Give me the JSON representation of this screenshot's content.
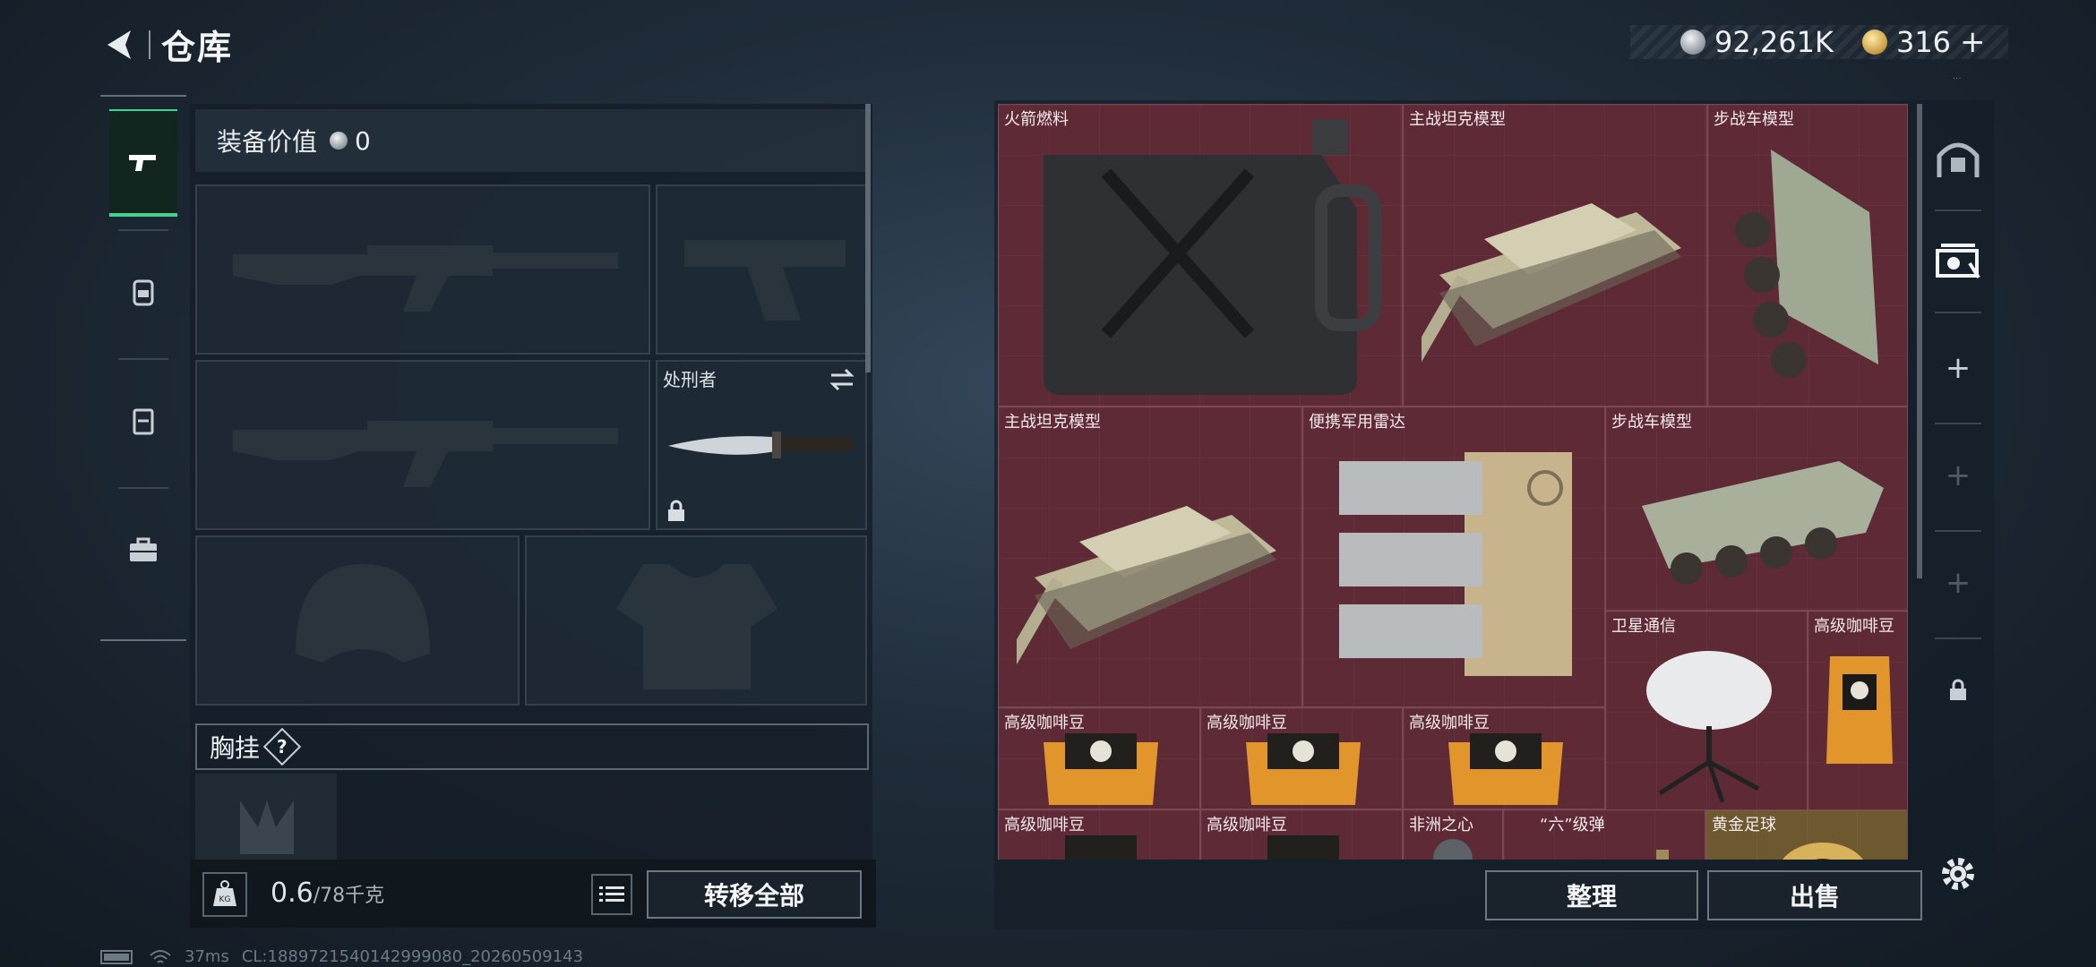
{
  "header": {
    "title": "仓库"
  },
  "currency": {
    "silver": "92,261K",
    "gold": "316"
  },
  "version": "...",
  "sidebar_left": {
    "tabs": [
      "weapon-tab",
      "backpack-tab",
      "chest-rig-tab",
      "case-tab"
    ]
  },
  "equipment": {
    "value_label": "装备价值",
    "value": "0",
    "melee_label": "处刑者",
    "chest_rig_label": "胸挂"
  },
  "footer_left": {
    "weight_current": "0.6",
    "weight_max": "/78千克",
    "kg_badge": "KG",
    "transfer_all": "转移全部"
  },
  "stash_items": [
    {
      "name": "火箭燃料"
    },
    {
      "name": "主战坦克模型"
    },
    {
      "name": "步战车模型"
    },
    {
      "name": "主战坦克模型"
    },
    {
      "name": "便携军用雷达"
    },
    {
      "name": "步战车模型"
    },
    {
      "name": "卫星通信"
    },
    {
      "name": "高级咖啡豆"
    },
    {
      "name": "高级咖啡豆"
    },
    {
      "name": "高级咖啡豆"
    },
    {
      "name": "高级咖啡豆"
    },
    {
      "name": "高级咖啡豆"
    },
    {
      "name": "高级咖啡豆"
    },
    {
      "name": "非洲之心"
    },
    {
      "name": "“六”级弹"
    },
    {
      "name": "黄金足球"
    }
  ],
  "footer_right": {
    "organize": "整理",
    "sell": "出售"
  },
  "status_bar": {
    "ping": "37ms",
    "id": "CL:1889721540142999080_20260509143"
  },
  "colors": {
    "accent_green": "#46d18f",
    "grid_red": "#5e2a36",
    "gold": "#c79a3c"
  }
}
